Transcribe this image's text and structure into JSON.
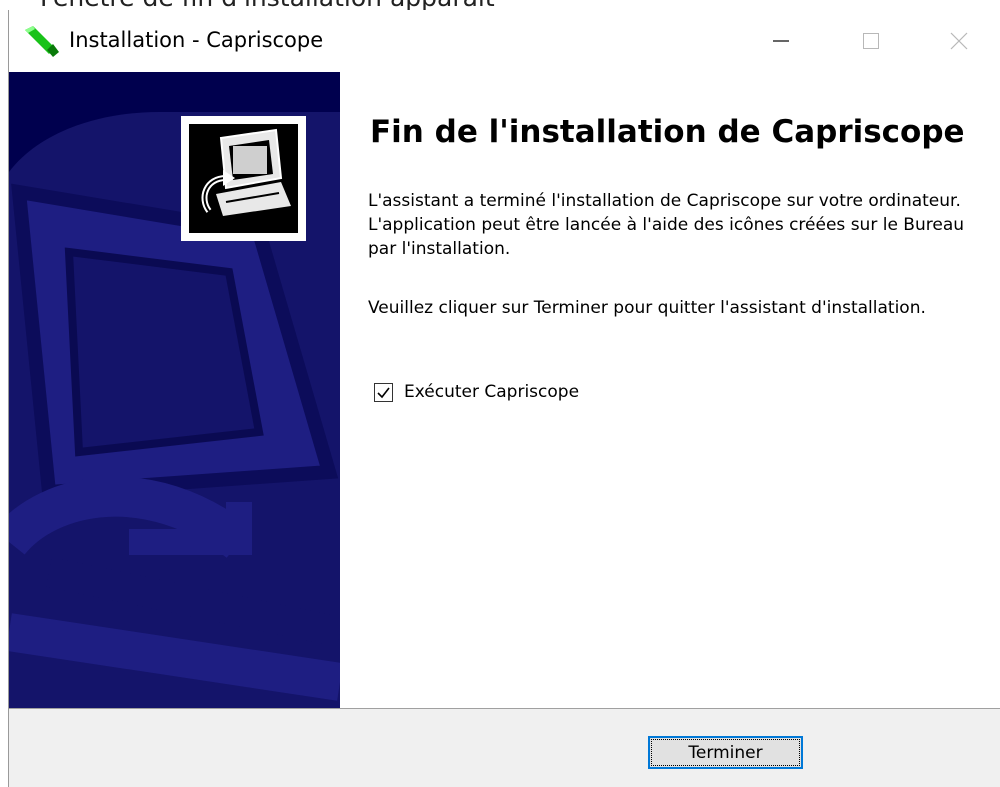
{
  "background_text": "Fenêtre de fin d'installation apparaît",
  "window": {
    "title": "Installation - Capriscope",
    "controls": {
      "minimize": "minimize-icon",
      "maximize": "maximize-icon",
      "close": "close-icon"
    }
  },
  "content": {
    "heading": "Fin de l'installation de Capriscope",
    "paragraph1": "L'assistant a terminé l'installation de Capriscope sur votre ordinateur. L'application peut être lancée à l'aide des icônes créées sur le Bureau par l'installation.",
    "paragraph2": "Veuillez cliquer sur Terminer pour quitter l'assistant d'installation.",
    "run_checkbox": {
      "label": "Exécuter Capriscope",
      "checked": true
    }
  },
  "footer": {
    "finish_label": "Terminer"
  },
  "colors": {
    "sidebar_bg": "#00004e",
    "sidebar_shape": "#1a1a78",
    "button_focus_border": "#0078d7",
    "footer_bg": "#f0f0f0"
  }
}
